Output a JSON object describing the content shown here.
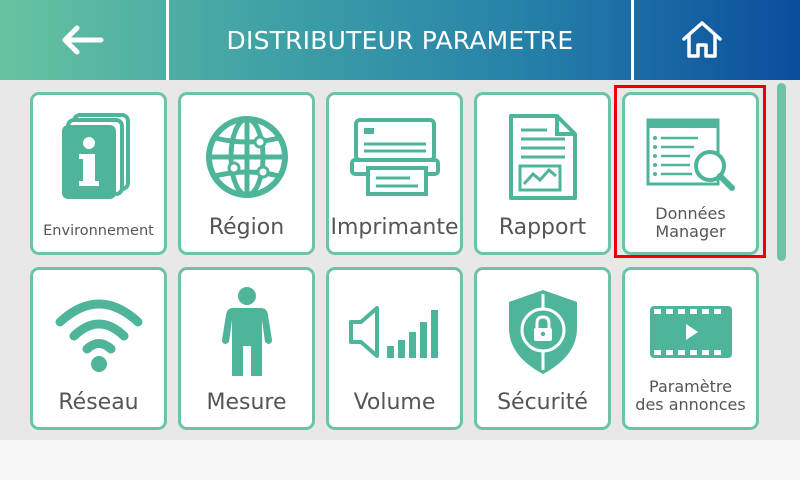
{
  "header": {
    "title": "DISTRIBUTEUR PARAMETRE",
    "back_icon": "arrow-left-icon",
    "home_icon": "home-icon"
  },
  "tiles": [
    {
      "label": "Environnement",
      "icon": "info-documents-icon"
    },
    {
      "label": "Région",
      "icon": "globe-icon"
    },
    {
      "label": "Imprimante",
      "icon": "printer-icon"
    },
    {
      "label": "Rapport",
      "icon": "report-document-icon"
    },
    {
      "label": "Données",
      "label2": "Manager",
      "icon": "data-manager-search-icon",
      "selected": true
    },
    {
      "label": "Réseau",
      "icon": "wifi-icon"
    },
    {
      "label": "Mesure",
      "icon": "person-measure-icon"
    },
    {
      "label": "Volume",
      "icon": "volume-icon"
    },
    {
      "label": "Sécurité",
      "icon": "security-shield-icon"
    },
    {
      "label": "Paramètre",
      "label2": "des annonces",
      "icon": "video-ad-icon"
    }
  ],
  "colors": {
    "accent": "#6cc3a6",
    "icon": "#4fb59a",
    "label": "#555555",
    "highlight": "#ee0000",
    "header_start": "#66c3a0",
    "header_end": "#0b4d9d"
  }
}
